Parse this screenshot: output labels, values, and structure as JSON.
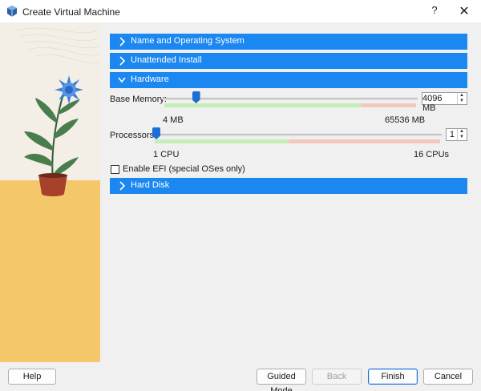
{
  "window": {
    "title": "Create Virtual Machine",
    "help_glyph": "?",
    "close_glyph": "✕"
  },
  "sections": {
    "name_os": "Name and Operating System",
    "unattended": "Unattended Install",
    "hardware": "Hardware",
    "hard_disk": "Hard Disk"
  },
  "hardware": {
    "memory": {
      "label": "Base Memory:",
      "value": "4096 MB",
      "min_label": "4 MB",
      "max_label": "65536 MB",
      "fraction": 0.0625
    },
    "processors": {
      "label": "Processors:",
      "value": "1",
      "min_label": "1 CPU",
      "max_label": "16 CPUs",
      "fraction": 0.0
    },
    "efi_label": "Enable EFI (special OSes only)",
    "efi_checked": false
  },
  "buttons": {
    "help": "Help",
    "guided": "Guided Mode",
    "back": "Back",
    "finish": "Finish",
    "cancel": "Cancel"
  },
  "colors": {
    "section_bar": "#1b87f0",
    "accent": "#1b6fd4",
    "art_ground": "#f5c76b"
  }
}
